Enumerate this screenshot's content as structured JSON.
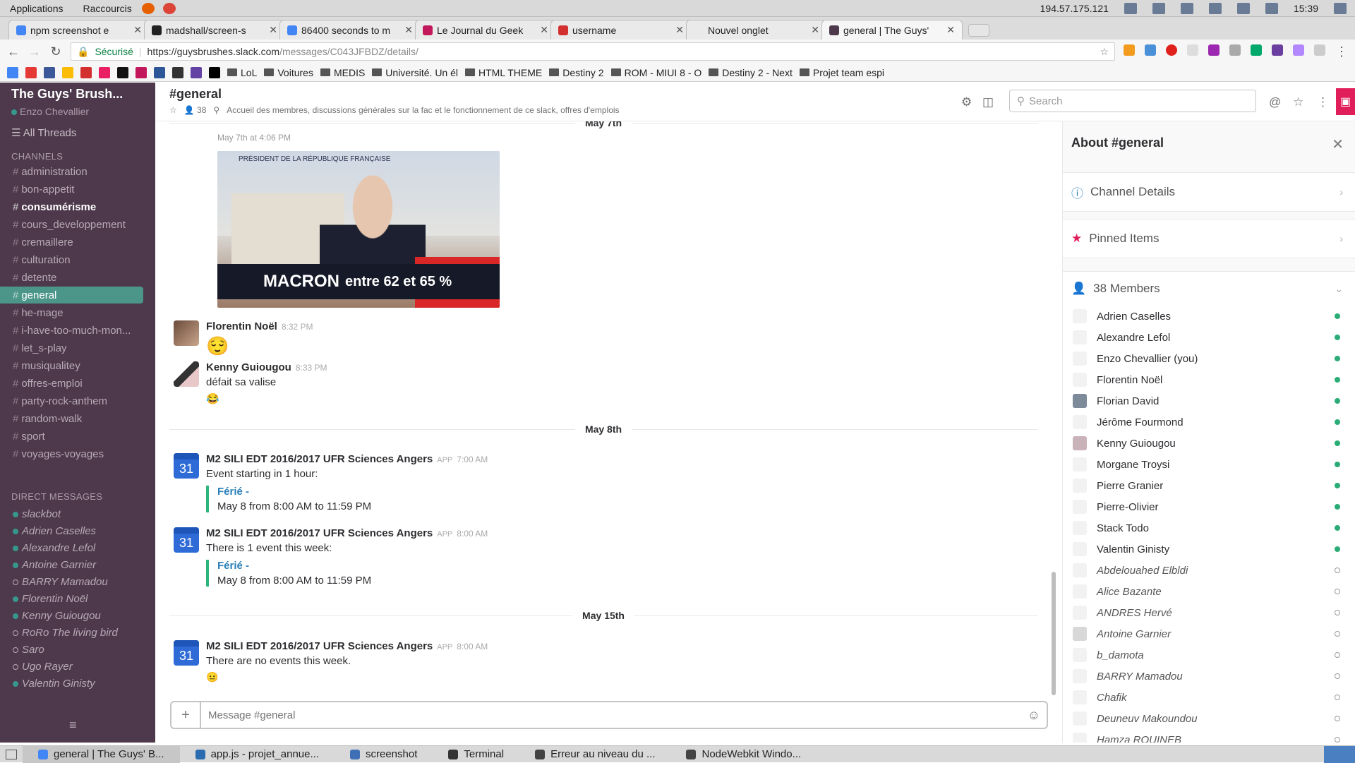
{
  "os": {
    "menus": [
      "Applications",
      "Raccourcis"
    ],
    "ip": "194.57.175.121",
    "time": "15:39"
  },
  "browser": {
    "tabs": [
      {
        "title": "npm screenshot e",
        "color": "#4285f4"
      },
      {
        "title": "madshall/screen-s",
        "color": "#222222"
      },
      {
        "title": "86400 seconds to m",
        "color": "#4285f4"
      },
      {
        "title": "Le Journal du Geek",
        "color": "#c2185b"
      },
      {
        "title": "username",
        "color": "#d32f2f"
      },
      {
        "title": "Nouvel onglet",
        "color": "#eaeaea"
      },
      {
        "title": "general | The Guys'",
        "color": "#4d394b"
      }
    ],
    "url_secure": "Sécurisé",
    "url": "https://guysbrushes.slack.com",
    "url_path": "/messages/C043JFBDZ/details/",
    "bookmarks": [
      "LoL",
      "Voitures",
      "MEDIS",
      "Université. Un él",
      "HTML THEME",
      "Destiny 2",
      "ROM - MIUI 8 - O",
      "Destiny 2 - Next",
      "Projet team espi"
    ]
  },
  "sidebar": {
    "team": "The Guys' Brush...",
    "user": "Enzo Chevallier",
    "all_threads": "All Threads",
    "channels_header": "CHANNELS",
    "channels": [
      {
        "name": "administration",
        "style": ""
      },
      {
        "name": "bon-appetit",
        "style": ""
      },
      {
        "name": "consumérisme",
        "style": "bold"
      },
      {
        "name": "cours_developpement",
        "style": ""
      },
      {
        "name": "cremaillere",
        "style": ""
      },
      {
        "name": "culturation",
        "style": ""
      },
      {
        "name": "detente",
        "style": ""
      },
      {
        "name": "general",
        "style": "active"
      },
      {
        "name": "he-mage",
        "style": ""
      },
      {
        "name": "i-have-too-much-mon...",
        "style": ""
      },
      {
        "name": "let_s-play",
        "style": ""
      },
      {
        "name": "musiqualitey",
        "style": ""
      },
      {
        "name": "offres-emploi",
        "style": ""
      },
      {
        "name": "party-rock-anthem",
        "style": ""
      },
      {
        "name": "random-walk",
        "style": ""
      },
      {
        "name": "sport",
        "style": ""
      },
      {
        "name": "voyages-voyages",
        "style": ""
      }
    ],
    "dm_header": "DIRECT MESSAGES",
    "dms": [
      {
        "name": "slackbot",
        "online": true
      },
      {
        "name": "Adrien Caselles",
        "online": true
      },
      {
        "name": "Alexandre Lefol",
        "online": true
      },
      {
        "name": "Antoine Garnier",
        "online": true
      },
      {
        "name": "BARRY Mamadou",
        "online": false
      },
      {
        "name": "Florentin Noël",
        "online": true
      },
      {
        "name": "Kenny Guiougou",
        "online": true
      },
      {
        "name": "RoRo The living bird",
        "online": false
      },
      {
        "name": "Saro",
        "online": false
      },
      {
        "name": "Ugo Rayer",
        "online": false
      },
      {
        "name": "Valentin Ginisty",
        "online": true
      }
    ]
  },
  "channel": {
    "name": "#general",
    "members_count": "38",
    "topic": "Accueil des membres, discussions générales sur la fac et le fonctionnement de ce slack, offres d'emplois",
    "search_placeholder": "Search"
  },
  "messages": {
    "day1": "May 7th",
    "top_time": "May 7th at 4:06 PM",
    "promo_kicker": "PRÉSIDENT DE LA RÉPUBLIQUE FRANÇAISE",
    "promo_name": "MACRON",
    "promo_text": "entre 62 et 65 %",
    "m1_author": "Florentin Noël",
    "m1_time": "8:32 PM",
    "m2_author": "Kenny Guiougou",
    "m2_time": "8:33 PM",
    "m2_text": "défait sa valise",
    "day2": "May 8th",
    "m3_author": "M2 SILI EDT 2016/2017 UFR Sciences Angers",
    "app_label": "APP",
    "m3_time": "7:00 AM",
    "m3_text": "Event starting in 1 hour:",
    "event_title": "Férié -",
    "event_date": "May 8 from 8:00 AM to 11:59 PM",
    "m4_time": "8:00 AM",
    "m4_text": "There is 1 event this week:",
    "day3": "May 15th",
    "m5_time": "8:00 AM",
    "m5_text": "There are no events this week.",
    "cal_day": "31",
    "composer_placeholder": "Message #general"
  },
  "about": {
    "title": "About #general",
    "channel_details": "Channel Details",
    "pinned": "Pinned Items",
    "members_label": "38 Members",
    "members": [
      {
        "name": "Adrien Caselles",
        "online": true
      },
      {
        "name": "Alexandre Lefol",
        "online": true
      },
      {
        "name": "Enzo Chevallier (you)",
        "online": true
      },
      {
        "name": "Florentin Noël",
        "online": true
      },
      {
        "name": "Florian David",
        "online": true
      },
      {
        "name": "Jérôme Fourmond",
        "online": true
      },
      {
        "name": "Kenny Guiougou",
        "online": true
      },
      {
        "name": "Morgane Troysi",
        "online": true
      },
      {
        "name": "Pierre Granier",
        "online": true
      },
      {
        "name": "Pierre-Olivier",
        "online": true
      },
      {
        "name": "Stack Todo",
        "online": true
      },
      {
        "name": "Valentin Ginisty",
        "online": true
      },
      {
        "name": "Abdelouahed Elbldi",
        "online": false
      },
      {
        "name": "Alice Bazante",
        "online": false
      },
      {
        "name": "ANDRES Hervé",
        "online": false
      },
      {
        "name": "Antoine Garnier",
        "online": false
      },
      {
        "name": "b_damota",
        "online": false
      },
      {
        "name": "BARRY Mamadou",
        "online": false
      },
      {
        "name": "Chafik",
        "online": false
      },
      {
        "name": "Deuneuv Makoundou",
        "online": false
      },
      {
        "name": "Hamza ROUINEB",
        "online": false
      }
    ]
  },
  "taskbar": [
    {
      "label": "general | The Guys' B...",
      "active": true
    },
    {
      "label": "app.js - projet_annue...",
      "active": false
    },
    {
      "label": "screenshot",
      "active": false
    },
    {
      "label": "Terminal",
      "active": false
    },
    {
      "label": "Erreur au niveau du ...",
      "active": false
    },
    {
      "label": "NodeWebkit Windo...",
      "active": false
    }
  ]
}
